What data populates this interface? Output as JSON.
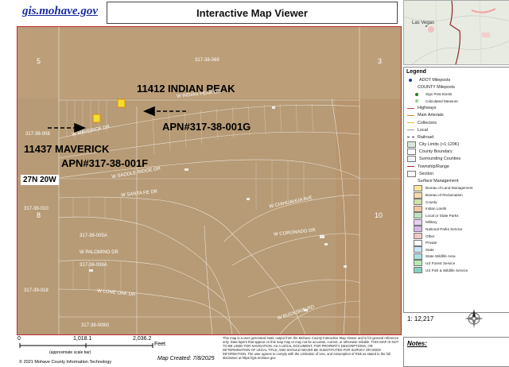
{
  "header": {
    "site": "gis.mohave.gov",
    "title": "Interactive Map Viewer"
  },
  "map": {
    "annotations": {
      "addr_peak": "11412 INDIAN PEAK",
      "apn_g": "APN#317-38-001G",
      "addr_maverick": "11437 MAVERICK",
      "apn_f": "APN#317-38-001F"
    },
    "township": "27N 20W",
    "sections": {
      "s5": "5",
      "s3": "3",
      "s8": "8",
      "s10": "10"
    },
    "parcels": {
      "p1": "317-38-069",
      "p2": "317-38-008",
      "p3": "317-38-010",
      "p4": "317-38-005A",
      "p5": "317-38-006A",
      "p6": "317-39-018",
      "p7": "317-38-008G"
    },
    "streets": {
      "st1": "W INDIAN PEAK DR",
      "st2": "W MAVERICK DR",
      "st3": "W SADDLE RIDGE DR",
      "st4": "W SANTA FE DR",
      "st5": "W PALOMINO DR",
      "st6": "W CHIHUAHUA AVE",
      "st7": "W CORONADO DR",
      "st8": "W LONE OAK DR",
      "st9": "W BUCKSKIN RD"
    },
    "parcel_colors": {
      "target": "#f2e02a",
      "outline": "#e08a1a"
    }
  },
  "inset": {
    "city1": "Las Vegas"
  },
  "legend": {
    "title": "Legend",
    "items": [
      {
        "label": "ADOT Mileposts",
        "kind": "dot",
        "color": "#1a3aa8"
      },
      {
        "label": "COUNTY Mileposts",
        "kind": "none",
        "color": "#ffffff"
      },
      {
        "label": "Sign Post Exists",
        "kind": "subdot",
        "color": "#2b7a2b"
      },
      {
        "label": "Calculated Measure",
        "kind": "subdot",
        "color": "#8fd08f"
      },
      {
        "label": "Highways",
        "kind": "line",
        "color": "#c04040"
      },
      {
        "label": "Main Arterials",
        "kind": "line",
        "color": "#e08020"
      },
      {
        "label": "Collectors",
        "kind": "line",
        "color": "#e0c020"
      },
      {
        "label": "Local",
        "kind": "line",
        "color": "#999999"
      },
      {
        "label": "Railroad",
        "kind": "rail",
        "color": "#333333"
      },
      {
        "label": "City Limits (>1:120K)",
        "kind": "box",
        "color": "#d8e8d8"
      },
      {
        "label": "County Boundary",
        "kind": "box",
        "color": "#ffffff"
      },
      {
        "label": "Surrounding Counties",
        "kind": "box",
        "color": "#f0f0f0"
      },
      {
        "label": "Township/Range",
        "kind": "line",
        "color": "#c02020"
      },
      {
        "label": "Section",
        "kind": "box",
        "color": "#ffffff"
      },
      {
        "label": "Surface Management",
        "kind": "none",
        "color": "#ffffff"
      },
      {
        "label": "Bureau of Land Management",
        "kind": "subbox",
        "color": "#fce89a"
      },
      {
        "label": "Bureau of Reclamation",
        "kind": "subbox",
        "color": "#f6d9a8"
      },
      {
        "label": "County",
        "kind": "subbox",
        "color": "#cfe3a8"
      },
      {
        "label": "Indian Lands",
        "kind": "subbox",
        "color": "#f2c8a0"
      },
      {
        "label": "Local or State Parks",
        "kind": "subbox",
        "color": "#bfe2bf"
      },
      {
        "label": "Military",
        "kind": "subbox",
        "color": "#e6d0f0"
      },
      {
        "label": "National Parks Service",
        "kind": "subbox",
        "color": "#d8b8e8"
      },
      {
        "label": "Other",
        "kind": "subbox",
        "color": "#f0c8c8"
      },
      {
        "label": "Private",
        "kind": "subbox",
        "color": "#ffffff"
      },
      {
        "label": "State",
        "kind": "subbox",
        "color": "#c8e8f8"
      },
      {
        "label": "State Wildlife Area",
        "kind": "subbox",
        "color": "#a8e0e0"
      },
      {
        "label": "US Forest Service",
        "kind": "subbox",
        "color": "#b8e8b0"
      },
      {
        "label": "US Fish & Wildlife Service",
        "kind": "subbox",
        "color": "#88d0c0"
      }
    ]
  },
  "scale_ratio": "1: 12,217",
  "scalebar": {
    "t0": "0",
    "t1": "1,018.1",
    "t2": "2,036.2",
    "unit": "Feet",
    "approx": "(approximate scale bar)"
  },
  "map_created": "Map Created: 7/8/2025",
  "copyright": "© 2021 Mohave County Information Technology",
  "disclaimer": "This map is a user generated static output from the Mohave County Interactive Map Viewer and is for general reference only. Data layers that appear on this map may or may not be accurate, current, or otherwise reliable. THIS MAP IS NOT TO BE USED FOR NAVIGATION. AS A LEGAL DOCUMENT, FOR PROPERTY DESCRIPTIONS, OR DETERMINATION OF LEGAL TITLE, AND SHOULD NEVER BE SUBSTITUTED FOR SURVEY OR DEED INFORMATION. The user agrees to comply with the Limitation of Use, and Assumption of Risk as stated in the full disclaimer at https://gis.mohave.gov",
  "notes_label": "Notes:"
}
